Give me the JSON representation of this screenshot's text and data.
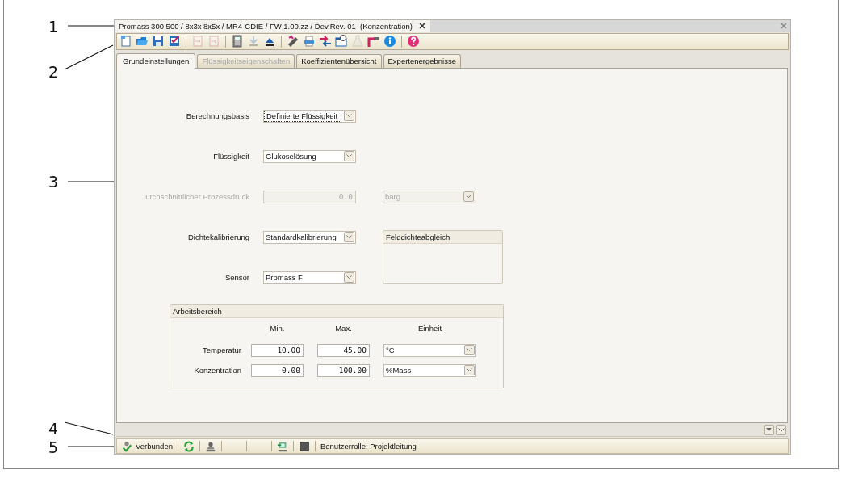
{
  "callouts": [
    {
      "label": "1"
    },
    {
      "label": "2"
    },
    {
      "label": "3"
    },
    {
      "label": "4"
    },
    {
      "label": "5"
    }
  ],
  "window": {
    "title": "Promass 300 500 / 8x3x 8x5x / MR4-CDIE / FW 1.00.zz / Dev.Rev. 01  (Konzentration)"
  },
  "toolbar": [
    {
      "kind": "new",
      "disabled": false
    },
    {
      "kind": "open",
      "disabled": false
    },
    {
      "kind": "save",
      "disabled": false
    },
    {
      "kind": "save-check",
      "disabled": false
    },
    {
      "kind": "separator"
    },
    {
      "kind": "import",
      "disabled": true
    },
    {
      "kind": "export",
      "disabled": true
    },
    {
      "kind": "separator"
    },
    {
      "kind": "calculator",
      "disabled": false
    },
    {
      "kind": "download",
      "disabled": true
    },
    {
      "kind": "upload",
      "disabled": false
    },
    {
      "kind": "separator"
    },
    {
      "kind": "ruler",
      "disabled": false
    },
    {
      "kind": "printer",
      "disabled": false
    },
    {
      "kind": "exchange",
      "disabled": false
    },
    {
      "kind": "clock",
      "disabled": false
    },
    {
      "kind": "flask",
      "disabled": true
    },
    {
      "kind": "pipe",
      "disabled": false
    },
    {
      "kind": "info",
      "disabled": false
    },
    {
      "kind": "separator"
    },
    {
      "kind": "help",
      "disabled": false
    }
  ],
  "tabs": [
    {
      "label": "Grundeinstellungen",
      "selected": true,
      "disabled": false
    },
    {
      "label": "Flüssigkeitseigenschaften",
      "selected": false,
      "disabled": true
    },
    {
      "label": "Koeffizientenübersicht",
      "selected": false,
      "disabled": false
    },
    {
      "label": "Expertenergebnisse",
      "selected": false,
      "disabled": false
    }
  ],
  "settings": [
    {
      "label": "Berechnungsbasis",
      "kind": "dropdown",
      "value": "Definierte Flüssigkeit",
      "focused": true,
      "disabled": false
    },
    {
      "label": "Flüssigkeit",
      "kind": "dropdown",
      "value": "Glukoselösung",
      "focused": false,
      "disabled": false
    },
    {
      "label": "urchschnittlicher Prozessdruck",
      "kind": "number-unit",
      "value": "0.0",
      "unit": "barg",
      "focused": false,
      "disabled": true
    },
    {
      "label": "Dichtekalibrierung",
      "kind": "dropdown",
      "value": "Standardkalibrierung",
      "focused": false,
      "disabled": false
    },
    {
      "label": "Sensor",
      "kind": "dropdown",
      "value": "Promass F",
      "focused": false,
      "disabled": false
    }
  ],
  "field_density": {
    "title": "Felddichteabgleich"
  },
  "working_range": {
    "title": "Arbeitsbereich",
    "columns": [
      "Min.",
      "Max.",
      "Einheit"
    ],
    "rows": [
      {
        "label": "Temperatur",
        "min": "10.00",
        "max": "45.00",
        "unit": "°C"
      },
      {
        "label": "Konzentration",
        "min": "0.00",
        "max": "100.00",
        "unit": "%Mass"
      }
    ]
  },
  "status_bar": [
    {
      "kind": "connection",
      "text": "Verbunden"
    },
    {
      "kind": "refresh"
    },
    {
      "kind": "user"
    },
    {
      "kind": "empty"
    },
    {
      "kind": "empty"
    },
    {
      "kind": "network"
    },
    {
      "kind": "square"
    },
    {
      "kind": "text",
      "text": "Benutzerrolle: Projektleitung"
    }
  ]
}
